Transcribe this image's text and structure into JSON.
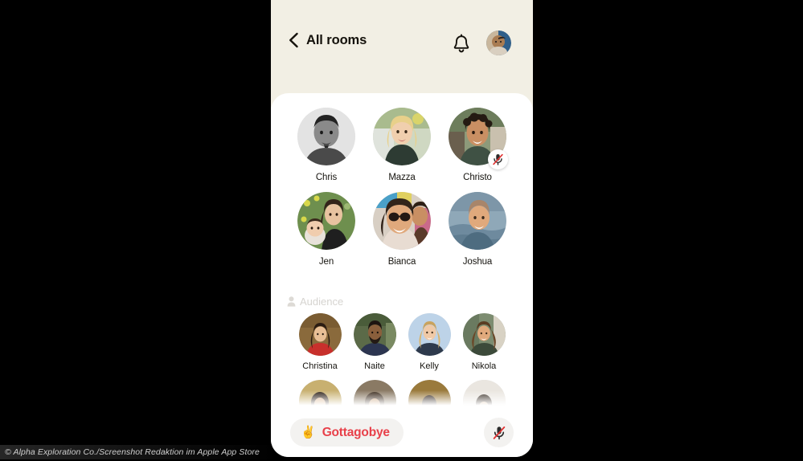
{
  "app": {
    "header": {
      "back_icon": "chevron-left-icon",
      "back_label": "All rooms",
      "bell_icon": "bell-icon",
      "avatar_name": "profile-avatar"
    },
    "colors": {
      "header_bg": "#f2efe4",
      "sheet_bg": "#ffffff",
      "leave_text": "#e8414a",
      "pill_bg": "#f3f2f0",
      "audience_label": "#d6d4d0",
      "name_text": "#16140f",
      "mute_slash": "#e03131"
    },
    "stage": {
      "speakers": [
        {
          "name": "Chris",
          "muted": false,
          "avatar": "avatar-chris"
        },
        {
          "name": "Mazza",
          "muted": false,
          "avatar": "avatar-mazza"
        },
        {
          "name": "Christo",
          "muted": true,
          "avatar": "avatar-christo"
        },
        {
          "name": "Jen",
          "muted": false,
          "avatar": "avatar-jen"
        },
        {
          "name": "Bianca",
          "muted": false,
          "avatar": "avatar-bianca"
        },
        {
          "name": "Joshua",
          "muted": false,
          "avatar": "avatar-joshua"
        }
      ]
    },
    "audience": {
      "icon": "person-icon",
      "label": "Audience",
      "members": [
        {
          "name": "Christina",
          "avatar": "avatar-christina"
        },
        {
          "name": "Naite",
          "avatar": "avatar-naite"
        },
        {
          "name": "Kelly",
          "avatar": "avatar-kelly"
        },
        {
          "name": "Nikola",
          "avatar": "avatar-nikola"
        }
      ],
      "partial_row": [
        {
          "name": "",
          "avatar": "avatar-row2-1"
        },
        {
          "name": "",
          "avatar": "avatar-row2-2"
        },
        {
          "name": "",
          "avatar": "avatar-row2-3"
        },
        {
          "name": "",
          "avatar": "avatar-row2-4"
        }
      ]
    },
    "bottom_bar": {
      "leave_emoji": "✌️",
      "leave_label": "Gottagobye",
      "mic_icon": "mic-muted-icon"
    }
  },
  "caption": {
    "text": "© Alpha Exploration Co./Screenshot Redaktion im Apple App Store"
  }
}
